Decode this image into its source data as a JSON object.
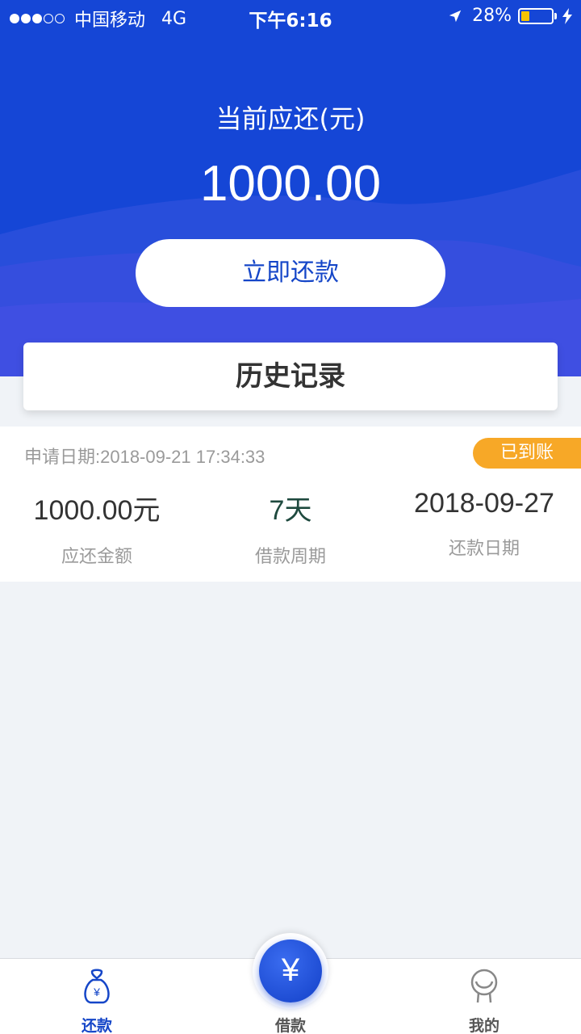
{
  "status_bar": {
    "signal_bars_filled": 3,
    "signal_bars_total": 5,
    "carrier": "中国移动",
    "network": "4G",
    "time": "下午6:16",
    "battery_percent": "28%",
    "battery_level": 0.28
  },
  "hero": {
    "due_label": "当前应还(元)",
    "due_amount": "1000.00",
    "pay_button": "立即还款"
  },
  "history": {
    "title": "历史记录"
  },
  "record": {
    "apply_date": "申请日期:2018-09-21 17:34:33",
    "status": "已到账",
    "amount_value": "1000.00元",
    "amount_label": "应还金额",
    "period_value": "7天",
    "period_label": "借款周期",
    "repay_date_value": "2018-09-27",
    "repay_date_label": "还款日期"
  },
  "tabbar": {
    "repay": "还款",
    "borrow": "借款",
    "borrow_symbol": "¥",
    "mine": "我的",
    "repay_symbol": "¥"
  },
  "colors": {
    "primary": "#1546d6",
    "badge": "#f7a827"
  }
}
